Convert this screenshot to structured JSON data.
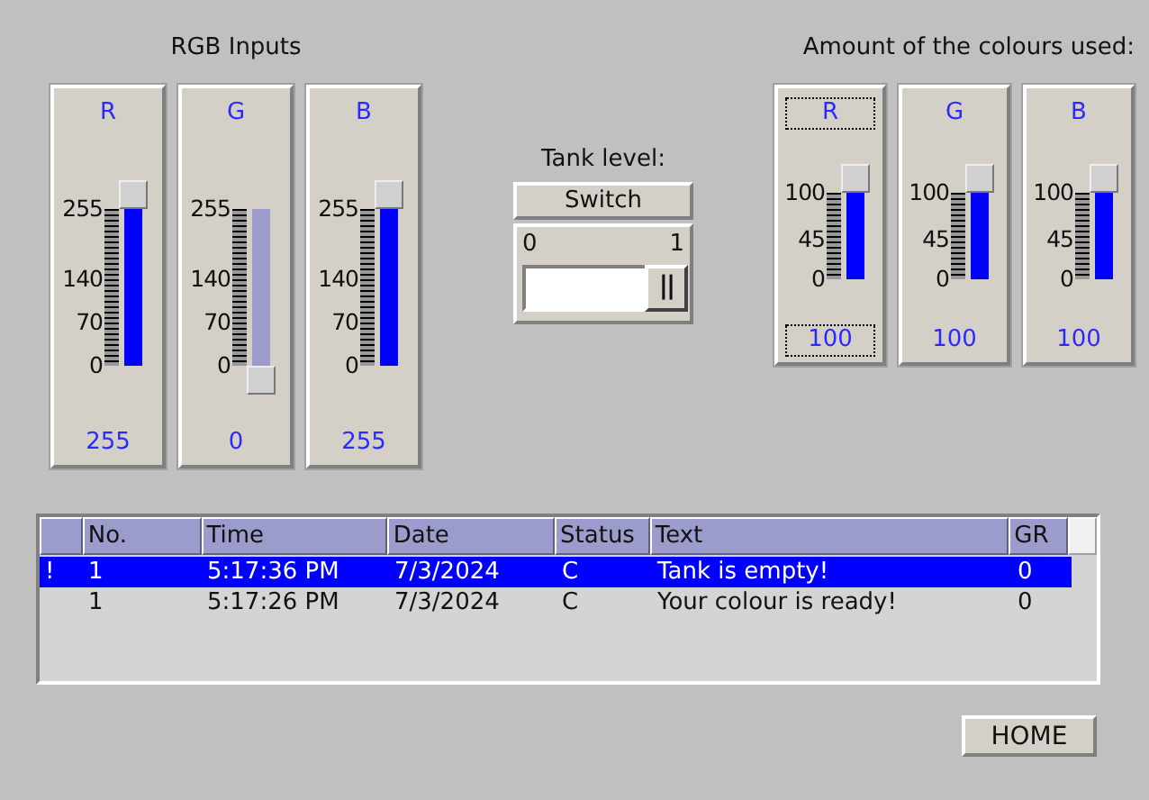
{
  "rgb_inputs": {
    "title": "RGB Inputs",
    "sliders": [
      {
        "label": "R",
        "ticks": [
          "255",
          "140",
          "70",
          "0"
        ],
        "level": 1,
        "value": "255"
      },
      {
        "label": "G",
        "ticks": [
          "255",
          "140",
          "70",
          "0"
        ],
        "level": 0,
        "value": "0"
      },
      {
        "label": "B",
        "ticks": [
          "255",
          "140",
          "70",
          "0"
        ],
        "level": 1,
        "value": "255"
      }
    ]
  },
  "tank": {
    "label": "Tank level:",
    "button": "Switch",
    "min_label": "0",
    "max_label": "1",
    "level": 1,
    "thumb": "||"
  },
  "colours_used": {
    "title": "Amount of the colours used:",
    "gauges": [
      {
        "label": "R",
        "ticks": [
          "100",
          "45",
          "0"
        ],
        "level": 1,
        "value": "100",
        "focused": true
      },
      {
        "label": "G",
        "ticks": [
          "100",
          "45",
          "0"
        ],
        "level": 1,
        "value": "100",
        "focused": false
      },
      {
        "label": "B",
        "ticks": [
          "100",
          "45",
          "0"
        ],
        "level": 1,
        "value": "100",
        "focused": false
      }
    ]
  },
  "alarm_table": {
    "columns": [
      "No.",
      "Time",
      "Date",
      "Status",
      "Text",
      "GR"
    ],
    "rows": [
      {
        "marker": "!",
        "cells": [
          "1",
          "5:17:36 PM",
          "7/3/2024",
          "C",
          "Tank is empty!",
          "0"
        ],
        "selected": true
      },
      {
        "cells": [
          "1",
          "5:17:26 PM",
          "7/3/2024",
          "C",
          "Your colour is ready!",
          "0"
        ],
        "selected": false
      }
    ]
  },
  "home_button": "HOME"
}
